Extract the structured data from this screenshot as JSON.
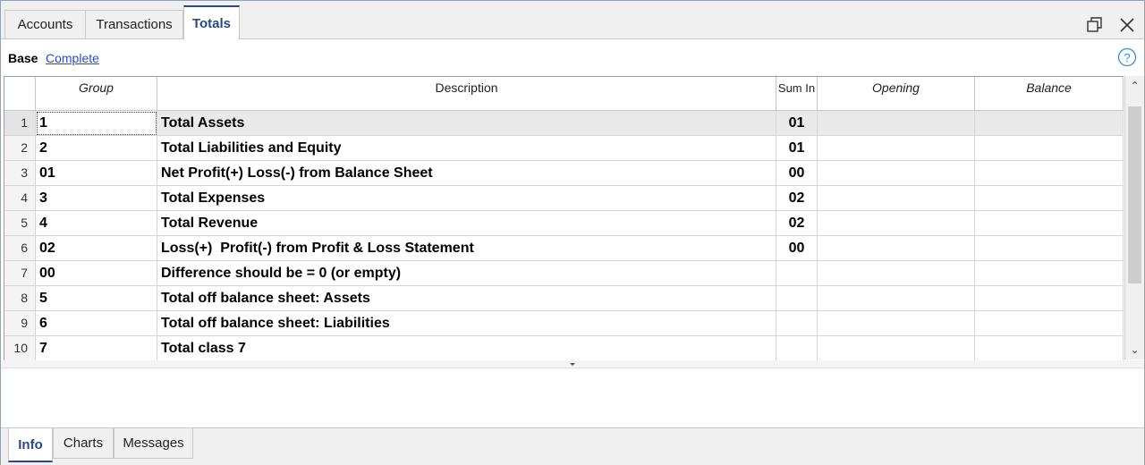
{
  "tabs": [
    {
      "label": "Accounts",
      "active": false
    },
    {
      "label": "Transactions",
      "active": false
    },
    {
      "label": "Totals",
      "active": true
    }
  ],
  "window_icons": [
    "restore-icon",
    "close-icon"
  ],
  "view": {
    "base_label": "Base",
    "complete_label": "Complete",
    "help_icon": "help-icon"
  },
  "table": {
    "columns": [
      "Group",
      "Description",
      "Sum In",
      "Opening",
      "Balance"
    ],
    "rows": [
      {
        "n": "1",
        "group": "1",
        "description": "Total Assets",
        "sum_in": "01",
        "opening": "",
        "balance": ""
      },
      {
        "n": "2",
        "group": "2",
        "description": "Total Liabilities and Equity",
        "sum_in": "01",
        "opening": "",
        "balance": ""
      },
      {
        "n": "3",
        "group": "01",
        "description": "Net Profit(+) Loss(-) from Balance Sheet",
        "sum_in": "00",
        "opening": "",
        "balance": ""
      },
      {
        "n": "4",
        "group": "3",
        "description": "Total Expenses",
        "sum_in": "02",
        "opening": "",
        "balance": ""
      },
      {
        "n": "5",
        "group": "4",
        "description": "Total Revenue",
        "sum_in": "02",
        "opening": "",
        "balance": ""
      },
      {
        "n": "6",
        "group": "02",
        "description": "Loss(+)  Profit(-) from Profit & Loss Statement",
        "sum_in": "00",
        "opening": "",
        "balance": ""
      },
      {
        "n": "7",
        "group": "00",
        "description": "Difference should be = 0 (or empty)",
        "sum_in": "",
        "opening": "",
        "balance": ""
      },
      {
        "n": "8",
        "group": "5",
        "description": "Total off balance sheet: Assets",
        "sum_in": "",
        "opening": "",
        "balance": ""
      },
      {
        "n": "9",
        "group": "6",
        "description": "Total off balance sheet: Liabilities",
        "sum_in": "",
        "opening": "",
        "balance": ""
      },
      {
        "n": "10",
        "group": "7",
        "description": "Total class 7",
        "sum_in": "",
        "opening": "",
        "balance": ""
      }
    ]
  },
  "bottom_tabs": [
    {
      "label": "Info",
      "active": true
    },
    {
      "label": "Charts",
      "active": false
    },
    {
      "label": "Messages",
      "active": false
    }
  ],
  "colors": {
    "accent": "#2b4a85",
    "link": "#1f4fd6",
    "selected_row": "#e9e9e9"
  }
}
